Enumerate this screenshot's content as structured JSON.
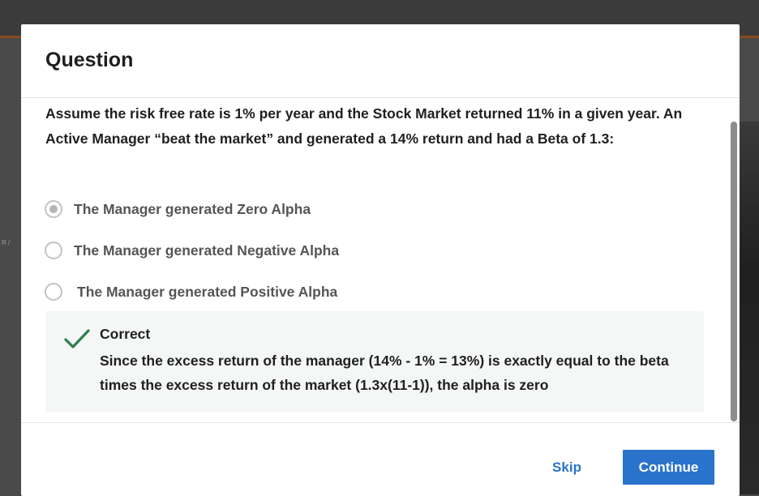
{
  "modal": {
    "title": "Question",
    "question": "Assume the risk free rate is 1% per year and the Stock Market returned 11% in a given year. An Active Manager “beat the market” and generated a 14% return and had a Beta of 1.3:",
    "options": [
      {
        "label": "The Manager generated Zero Alpha",
        "selected": true
      },
      {
        "label": "The Manager generated Negative Alpha",
        "selected": false
      },
      {
        "label": "The Manager generated Positive Alpha",
        "selected": false
      }
    ],
    "feedback": {
      "title": "Correct",
      "text": "Since the excess return of the manager (14% - 1% = 13%) is exactly equal to the beta times the excess return of the market (1.3x(11-1)), the alpha is zero",
      "icon": "checkmark-icon",
      "icon_color": "#2e7d4f"
    },
    "footer": {
      "skip_label": "Skip",
      "continue_label": "Continue"
    }
  },
  "background": {
    "side_text": "R /"
  },
  "colors": {
    "accent": "#2a73cc",
    "feedback_bg": "#f4f7f5"
  }
}
